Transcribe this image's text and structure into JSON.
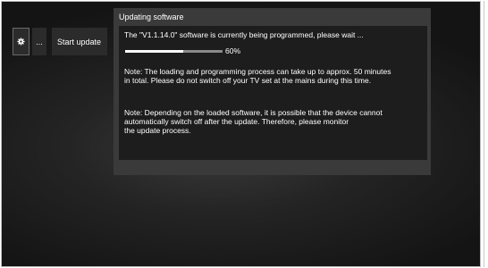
{
  "toolbar": {
    "gear_icon": "gear-icon",
    "more_label": "...",
    "start_update_label": "Start update"
  },
  "dialog": {
    "title": "Updating software",
    "message": "The \"V1.1.14.0\" software is currently being programmed, please wait ...",
    "progress": {
      "percent": 60,
      "label": "60%"
    },
    "note1": "Note: The loading and programming process can take up to approx. 50 minutes\nin total. Please do not switch off your TV set at the mains during this time.",
    "note2": "Note: Depending on the loaded software, it is possible that the device cannot\nautomatically switch off after the update. Therefore, please monitor\nthe update process."
  },
  "colors": {
    "background_dark": "#1d1d1d",
    "dialog_frame": "#3a3a3a",
    "progress_fill": "#ffffff",
    "progress_track": "#8a8a8a",
    "text": "#ffffff"
  }
}
